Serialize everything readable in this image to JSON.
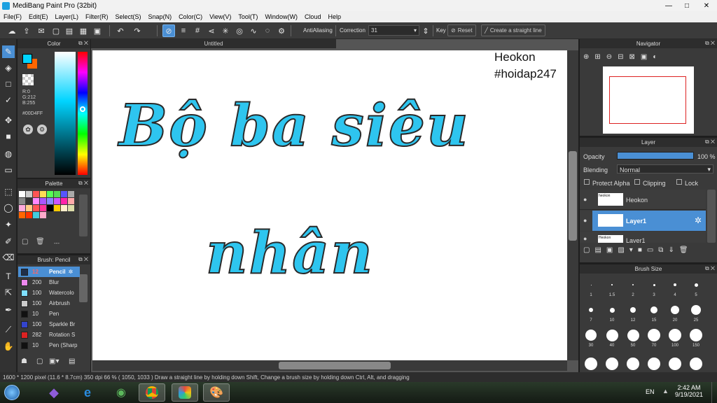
{
  "window": {
    "title": "MediBang Paint Pro (32bit)",
    "min": "—",
    "max": "□",
    "close": "✕"
  },
  "menu": [
    "File(F)",
    "Edit(E)",
    "Layer(L)",
    "Filter(R)",
    "Select(S)",
    "Snap(N)",
    "Color(C)",
    "View(V)",
    "Tool(T)",
    "Window(W)",
    "Cloud",
    "Help"
  ],
  "toolbar": {
    "antialiasing": "AntiAliasing",
    "correction_label": "Correction",
    "correction_value": "31",
    "key": "Key",
    "reset": "Reset",
    "straight": "Create a straight line"
  },
  "color_panel": {
    "title": "Color",
    "r": "R:0",
    "g": "G:212",
    "b": "B:255",
    "hex": "#00D4FF"
  },
  "palette_panel": {
    "title": "Palette",
    "dash": "---"
  },
  "brush_panel": {
    "title": "Brush: Pencil",
    "items": [
      {
        "size": "12",
        "name": "Pencil",
        "color": "#1f2f4a",
        "selected": true
      },
      {
        "size": "200",
        "name": "Blur",
        "color": "#ee88ee"
      },
      {
        "size": "100",
        "name": "Watercolo",
        "color": "#7fe0ff"
      },
      {
        "size": "100",
        "name": "Airbrush",
        "color": "#cccccc"
      },
      {
        "size": "10",
        "name": "Pen",
        "color": "#111111"
      },
      {
        "size": "100",
        "name": "Sparkle Br",
        "color": "#3344cc"
      },
      {
        "size": "282",
        "name": "Rotation S",
        "color": "#dd2222"
      },
      {
        "size": "10",
        "name": "Pen (Sharp",
        "color": "#111111"
      }
    ]
  },
  "document": {
    "tab": "Untitled",
    "heokon": "Heokon",
    "hashtag": "#hoidap247",
    "line1": "Bộ ba siêu",
    "line2": "nhân"
  },
  "navigator": {
    "title": "Navigator"
  },
  "layer_panel": {
    "title": "Layer",
    "opacity_label": "Opacity",
    "opacity_value": "100 %",
    "blending_label": "Blending",
    "blending_value": "Normal",
    "protect_alpha": "Protect Alpha",
    "clipping": "Clipping",
    "lock": "Lock",
    "layers": [
      {
        "name": "Heokon",
        "thumb": "heokon"
      },
      {
        "name": "Layer1",
        "thumb": "",
        "selected": true
      },
      {
        "name": "Layer1",
        "thumb": "Heokon"
      }
    ]
  },
  "brush_size_panel": {
    "title": "Brush Size",
    "sizes": [
      "1",
      "1.5",
      "2",
      "3",
      "4",
      "5",
      "7",
      "10",
      "12",
      "15",
      "20",
      "25",
      "30",
      "40",
      "50",
      "70",
      "100",
      "150"
    ]
  },
  "status": {
    "text": "1600 * 1200 pixel   (11.6 * 8.7cm)   350 dpi   66 %   ( 1050, 1033 )   Draw a straight line by holding down Shift, Change a brush size by holding down Ctrl, Alt, and dragging"
  },
  "taskbar": {
    "lang": "EN",
    "time": "2:42 AM",
    "date": "9/19/2021"
  },
  "colors": {
    "primary": "#00d4ff",
    "secondary": "#ff6600",
    "accent": "#4a8fd4"
  }
}
